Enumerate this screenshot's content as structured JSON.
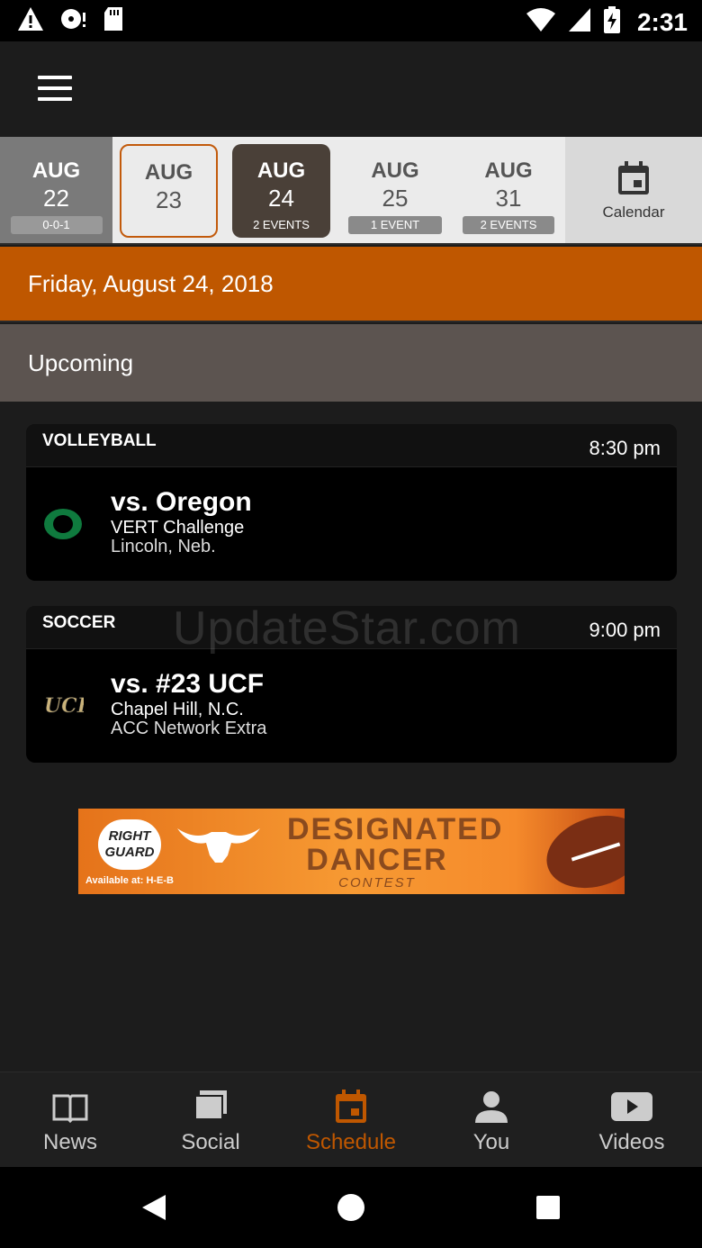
{
  "status_bar": {
    "time": "2:31"
  },
  "date_strip": {
    "cells": [
      {
        "month": "AUG",
        "day": "22",
        "tag": "0-0-1"
      },
      {
        "month": "AUG",
        "day": "23",
        "tag": ""
      },
      {
        "month": "AUG",
        "day": "24",
        "tag": "2 EVENTS"
      },
      {
        "month": "AUG",
        "day": "25",
        "tag": "1 EVENT"
      },
      {
        "month": "AUG",
        "day": "31",
        "tag": "2 EVENTS"
      }
    ],
    "calendar_label": "Calendar"
  },
  "date_banner": "Friday, August 24, 2018",
  "section_label": "Upcoming",
  "events": [
    {
      "sport": "VOLLEYBALL",
      "time": "8:30 pm",
      "opponent": "vs. Oregon",
      "line1": "VERT Challenge",
      "line2": "Lincoln, Neb.",
      "logo_icon": "oregon-o-logo"
    },
    {
      "sport": "SOCCER",
      "time": "9:00 pm",
      "opponent": "vs. #23 UCF",
      "line1": "Chapel Hill, N.C.",
      "line2": "ACC Network Extra",
      "logo_icon": "ucf-logo"
    }
  ],
  "watermark": "UpdateStar.com",
  "ad": {
    "brand": "RIGHT GUARD",
    "available": "Available at: H-E-B",
    "headline_1": "DESIGNATED",
    "headline_2": "DANCER",
    "sub": "CONTEST"
  },
  "bottom_nav": {
    "items": [
      {
        "label": "News",
        "icon": "book-icon"
      },
      {
        "label": "Social",
        "icon": "social-cards-icon"
      },
      {
        "label": "Schedule",
        "icon": "calendar-icon"
      },
      {
        "label": "You",
        "icon": "person-icon"
      },
      {
        "label": "Videos",
        "icon": "play-icon"
      }
    ],
    "active": "Schedule"
  },
  "colors": {
    "accent": "#bf5700",
    "banner_gray": "#5c5450",
    "background": "#1c1c1c"
  }
}
